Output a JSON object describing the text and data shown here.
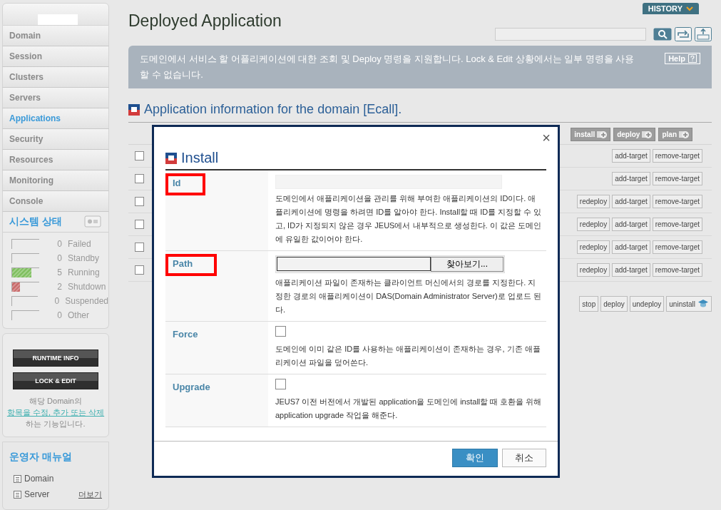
{
  "sidebar": {
    "nav": [
      {
        "label": "Domain",
        "selected": false
      },
      {
        "label": "Session",
        "selected": false
      },
      {
        "label": "Clusters",
        "selected": false
      },
      {
        "label": "Servers",
        "selected": false
      },
      {
        "label": "Applications",
        "selected": true
      },
      {
        "label": "Security",
        "selected": false
      },
      {
        "label": "Resources",
        "selected": false
      },
      {
        "label": "Monitoring",
        "selected": false
      },
      {
        "label": "Console",
        "selected": false
      }
    ],
    "status": {
      "title": "시스템 상태",
      "items": [
        {
          "count": "0",
          "label": "Failed"
        },
        {
          "count": "0",
          "label": "Standby"
        },
        {
          "count": "5",
          "label": "Running",
          "level": 0.71,
          "color": "#7fbf5f"
        },
        {
          "count": "2",
          "label": "Shutdown",
          "level": 0.29,
          "color": "#c86a6a"
        },
        {
          "count": "0",
          "label": "Suspended"
        },
        {
          "count": "0",
          "label": "Other"
        }
      ]
    },
    "buttons": [
      "RUNTIME INFO",
      "LOCK & EDIT"
    ],
    "note": {
      "before": "해당 Domain의 ",
      "link": "항목을 수정, 추가 또는 삭제",
      "after": "하는 기능입니다."
    },
    "manual": {
      "title": "운영자 매뉴얼",
      "links": [
        "Domain",
        "Server"
      ],
      "more": "더보기"
    }
  },
  "page": {
    "title": "Deployed Application",
    "history": "HISTORY",
    "banner": "도메인에서 서비스 할 어플리케이션에 대한 조회 및 Deploy 명령을 지원합니다. Lock & Edit 상황에서는 일부 명령을 사용할 수 없습니다.",
    "help": "Help",
    "heading": "Application information for the domain [Ecall].",
    "toolbar": [
      "install",
      "deploy",
      "plan"
    ],
    "rows": [
      {
        "checked": false,
        "actions": [
          "add-target",
          "remove-target"
        ]
      },
      {
        "checked": false,
        "actions": [
          "add-target",
          "remove-target"
        ]
      },
      {
        "checked": false,
        "actions": [
          "redeploy",
          "add-target",
          "remove-target"
        ]
      },
      {
        "checked": false,
        "actions": [
          "redeploy",
          "add-target",
          "remove-target"
        ]
      },
      {
        "checked": false,
        "actions": [
          "redeploy",
          "add-target",
          "remove-target"
        ]
      },
      {
        "checked": false,
        "actions": [
          "redeploy",
          "add-target",
          "remove-target"
        ]
      }
    ],
    "bottom_actions": [
      "stop",
      "deploy",
      "undeploy",
      "uninstall"
    ]
  },
  "dialog": {
    "title": "Install",
    "close": "×",
    "fields": [
      {
        "kind": "text",
        "label": "Id",
        "highlighted": true,
        "description": "도메인에서 애플리케이션을 관리를 위해 부여한 애플리케이션의 ID이다. 애플리케이션에 명령을 하려면 ID를 알아야 한다. Install할 때 ID를 지정할 수 있고, ID가 지정되지 않은 경우 JEUS에서 내부적으로 생성한다. 이 값은 도메인에 유일한 값이어야 한다."
      },
      {
        "kind": "file",
        "label": "Path",
        "highlighted": true,
        "button": "찾아보기...",
        "description": "애플리케이션 파일이 존재하는 클라이언트 머신에서의 경로를 지정한다. 지정한 경로의 애플리케이션이 DAS(Domain Administrator Server)로 업로드 된다."
      },
      {
        "kind": "checkbox",
        "label": "Force",
        "highlighted": false,
        "checked": false,
        "description": "도메인에 이미 같은 ID를 사용하는 애플리케이션이 존재하는 경우, 기존 애플리케이션 파일을 덮어쓴다."
      },
      {
        "kind": "checkbox",
        "label": "Upgrade",
        "highlighted": false,
        "checked": false,
        "description": "JEUS7 이전 버전에서 개발된 application을 도메인에 install할 때 호환을 위해 application upgrade 작업을 해준다."
      }
    ],
    "ok": "확인",
    "cancel": "취소"
  }
}
